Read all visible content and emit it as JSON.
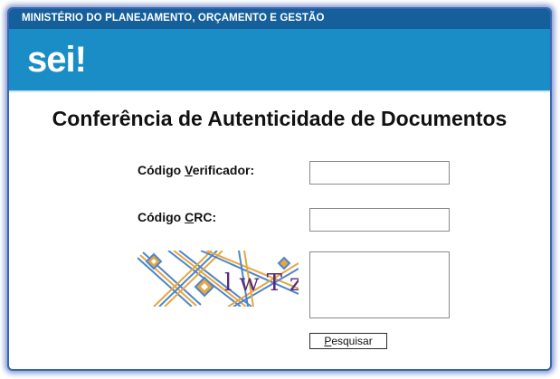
{
  "header": {
    "ministry": "MINISTÉRIO DO PLANEJAMENTO, ORÇAMENTO E GESTÃO",
    "logo_text": "sei",
    "logo_mark": "!"
  },
  "page": {
    "title": "Conferência de Autenticidade de Documentos"
  },
  "form": {
    "verificador": {
      "label_pre": "Código ",
      "label_key": "V",
      "label_post": "erificador:",
      "value": ""
    },
    "crc": {
      "label_pre": "Código ",
      "label_key": "C",
      "label_post": "RC:",
      "value": ""
    },
    "captcha": {
      "text": "lwTz",
      "answer": ""
    },
    "search_button": {
      "key": "P",
      "rest": "esquisar"
    }
  },
  "colors": {
    "ministry_bar": "#155f9a",
    "brand_bar": "#1a8dc6",
    "frame_border": "#3c64b4"
  }
}
